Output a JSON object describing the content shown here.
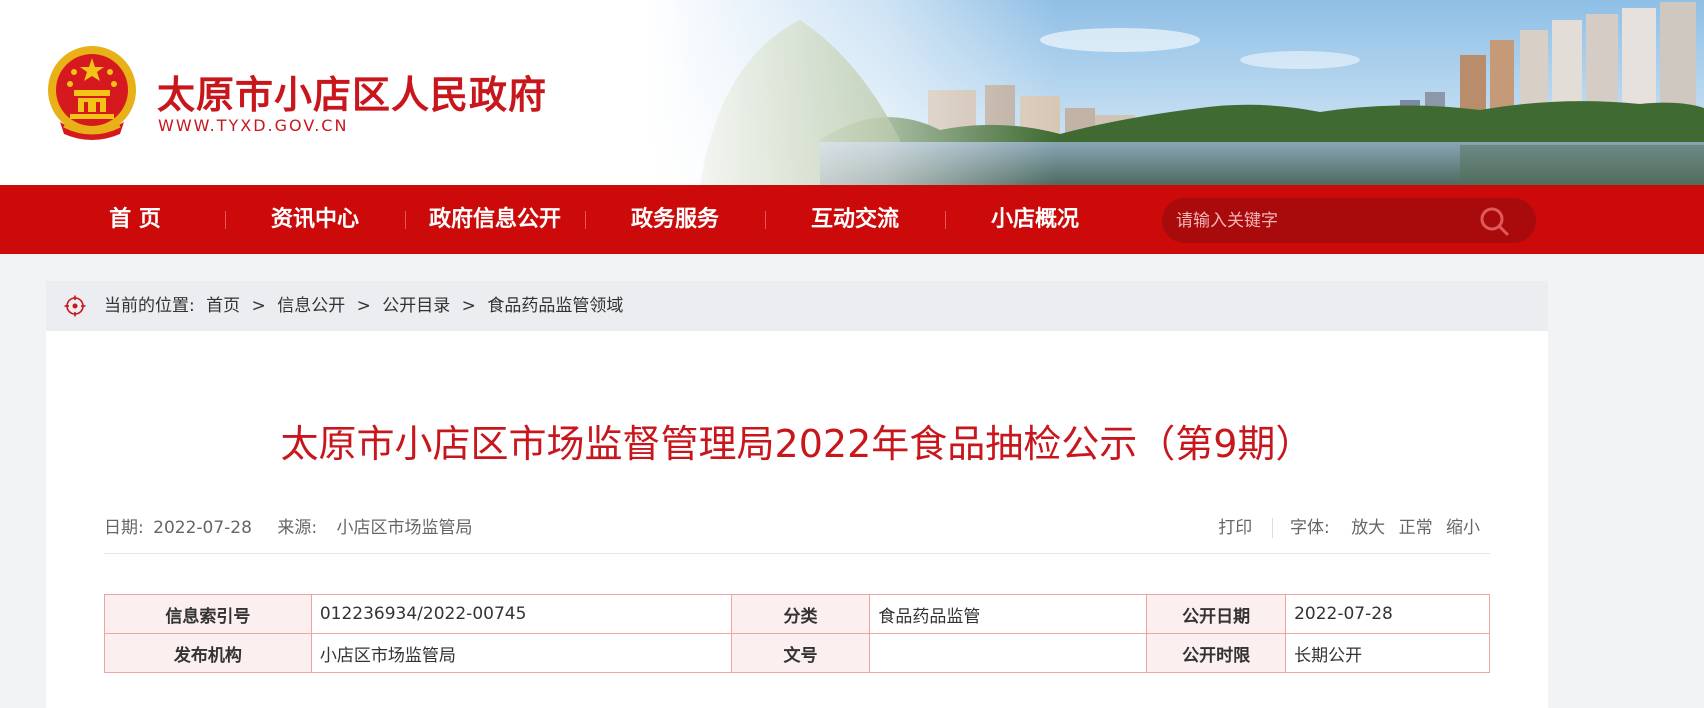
{
  "header": {
    "site_name": "太原市小店区人民政府",
    "site_domain": "WWW.TYXD.GOV.CN"
  },
  "nav": {
    "items": [
      "首 页",
      "资讯中心",
      "政府信息公开",
      "政务服务",
      "互动交流",
      "小店概况"
    ],
    "search_placeholder": "请输入关键字"
  },
  "breadcrumb": {
    "prefix": "当前的位置:",
    "items": [
      "首页",
      "信息公开",
      "公开目录",
      "食品药品监管领域"
    ],
    "separator": ">"
  },
  "article": {
    "title": "太原市小店区市场监督管理局2022年食品抽检公示（第9期）",
    "date_label": "日期:",
    "date": "2022-07-28",
    "source_label": "来源:",
    "source": "小店区市场监管局",
    "print_label": "打印",
    "font_label": "字体:",
    "font_large": "放大",
    "font_normal": "正常",
    "font_small": "缩小"
  },
  "info": {
    "index_label": "信息索引号",
    "index_value": "012236934/2022-00745",
    "category_label": "分类",
    "category_value": "食品药品监管",
    "pubdate_label": "公开日期",
    "pubdate_value": "2022-07-28",
    "org_label": "发布机构",
    "org_value": "小店区市场监管局",
    "docno_label": "文号",
    "docno_value": "",
    "term_label": "公开时限",
    "term_value": "长期公开"
  },
  "colors": {
    "brand_red": "#cc0a0a",
    "title_red": "#c8161d",
    "table_border": "#f0a5a5",
    "table_label_bg": "#fcefef"
  }
}
